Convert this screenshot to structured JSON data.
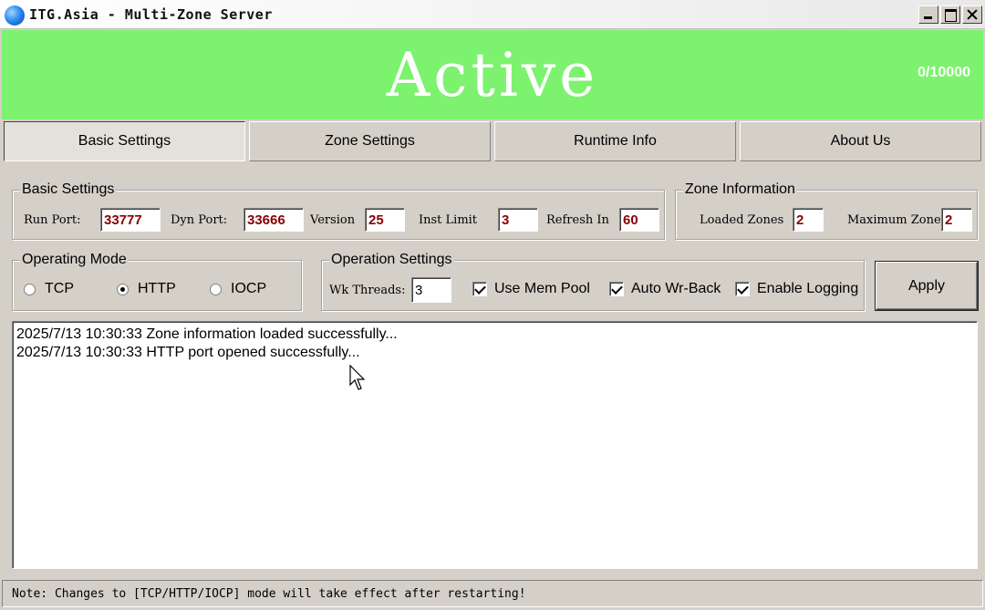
{
  "window": {
    "title": "ITG.Asia - Multi-Zone Server",
    "controls": [
      "minimize",
      "maximize",
      "close"
    ]
  },
  "banner": {
    "status": "Active",
    "connections": "0/10000",
    "color": "#7df26f"
  },
  "tabs": [
    {
      "label": "Basic Settings",
      "active": true
    },
    {
      "label": "Zone Settings",
      "active": false
    },
    {
      "label": "Runtime Info",
      "active": false
    },
    {
      "label": "About Us",
      "active": false
    }
  ],
  "basic_settings": {
    "title": "Basic Settings",
    "run_port": {
      "label": "Run Port:",
      "value": "33777"
    },
    "dyn_port": {
      "label": "Dyn Port:",
      "value": "33666"
    },
    "version": {
      "label": "Version",
      "value": "25"
    },
    "inst_limit": {
      "label": "Inst Limit",
      "value": "3"
    },
    "refresh_interval": {
      "label": "Refresh In",
      "value": "60"
    }
  },
  "zone_information": {
    "title": "Zone Information",
    "loaded_zones": {
      "label": "Loaded Zones",
      "value": "2"
    },
    "maximum_zones": {
      "label": "Maximum Zone:",
      "value": "2"
    }
  },
  "operating_mode": {
    "title": "Operating Mode",
    "options": [
      {
        "label": "TCP",
        "selected": false
      },
      {
        "label": "HTTP",
        "selected": true
      },
      {
        "label": "IOCP",
        "selected": false
      }
    ]
  },
  "operation_settings": {
    "title": "Operation Settings",
    "wk_threads": {
      "label": "Wk Threads:",
      "value": "3"
    },
    "use_mem_pool": {
      "label": "Use Mem Pool",
      "checked": true
    },
    "auto_wr_back": {
      "label": "Auto Wr-Back",
      "checked": true
    },
    "enable_logging": {
      "label": "Enable Logging",
      "checked": true
    }
  },
  "apply_button": "Apply",
  "log": [
    "2025/7/13 10:30:33 Zone information loaded successfully...",
    "2025/7/13 10:30:33 HTTP port opened successfully..."
  ],
  "status_note": "Note: Changes to [TCP/HTTP/IOCP] mode will take effect after restarting!"
}
